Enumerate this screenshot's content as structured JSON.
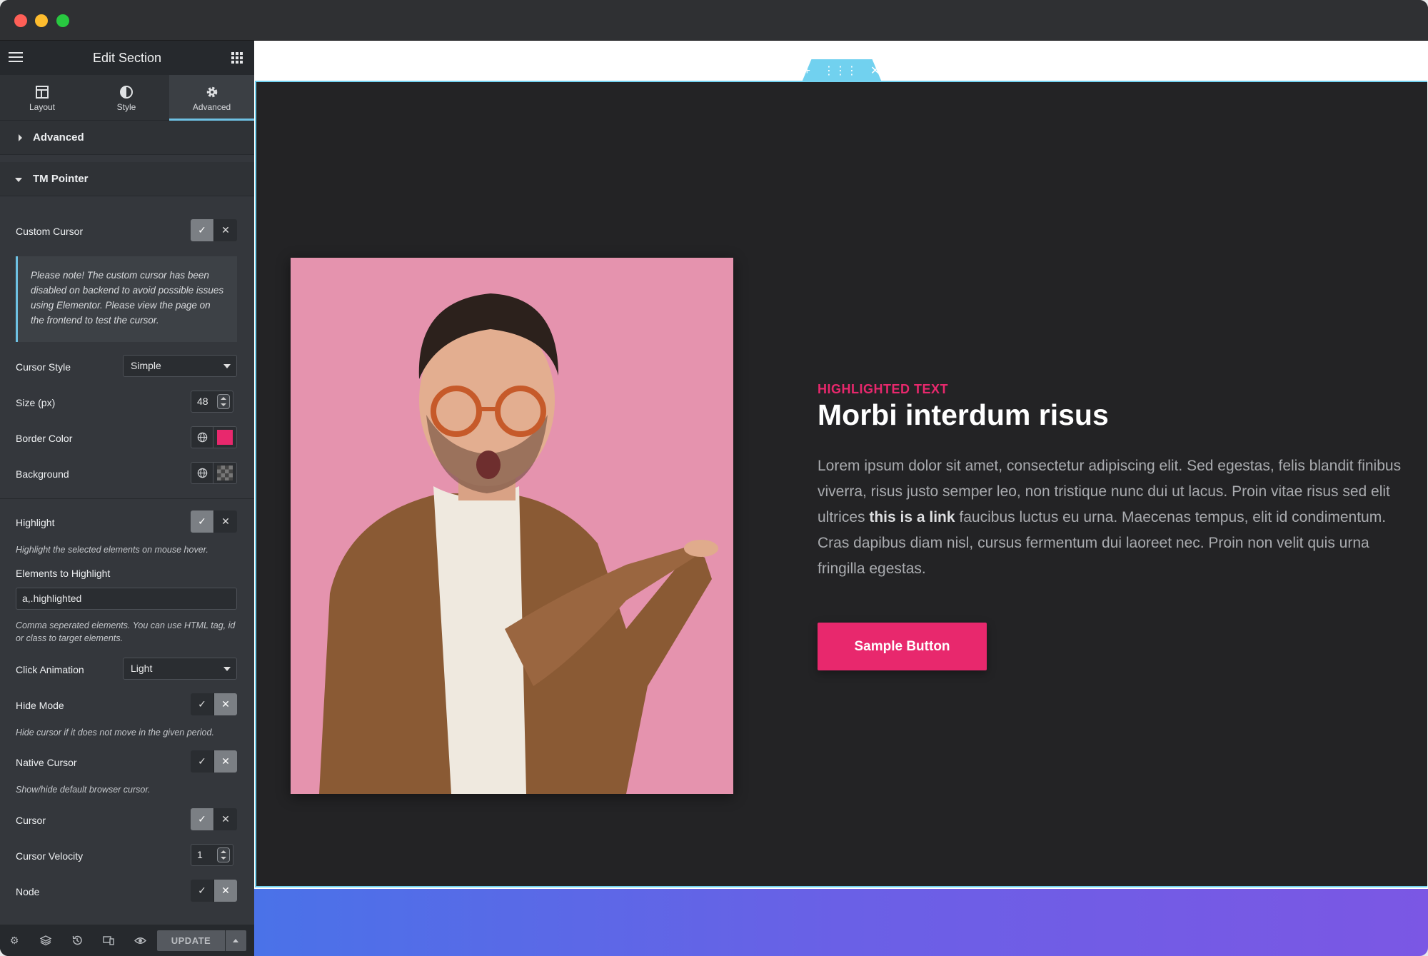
{
  "window": {
    "controls": [
      "close",
      "minimize",
      "maximize"
    ]
  },
  "panel": {
    "title": "Edit Section",
    "tabs": [
      {
        "label": "Layout",
        "icon": "layout-icon"
      },
      {
        "label": "Style",
        "icon": "style-icon"
      },
      {
        "label": "Advanced",
        "icon": "gear-icon",
        "active": true
      }
    ],
    "sections": {
      "advanced": "Advanced",
      "tm_pointer": "TM Pointer"
    },
    "custom_cursor": {
      "label": "Custom Cursor",
      "value": "on"
    },
    "note": "Please note! The custom cursor has been disabled on backend to avoid possible issues using Elementor. Please view the page on the frontend to test the cursor.",
    "cursor_style": {
      "label": "Cursor Style",
      "value": "Simple"
    },
    "size": {
      "label": "Size (px)",
      "value": "48"
    },
    "border_color": {
      "label": "Border Color",
      "value": "#e8286d"
    },
    "background": {
      "label": "Background"
    },
    "highlight": {
      "label": "Highlight",
      "value": "on",
      "hint": "Highlight the selected elements on mouse hover."
    },
    "elements_to_highlight": {
      "label": "Elements to Highlight",
      "value": "a,.highlighted",
      "hint": "Comma seperated elements. You can use HTML tag, id or class to target elements."
    },
    "click_animation": {
      "label": "Click Animation",
      "value": "Light"
    },
    "hide_mode": {
      "label": "Hide Mode",
      "value": "off",
      "hint": "Hide cursor if it does not move in the given period."
    },
    "native_cursor": {
      "label": "Native Cursor",
      "value": "off",
      "hint": "Show/hide default browser cursor."
    },
    "cursor": {
      "label": "Cursor",
      "value": "on"
    },
    "cursor_velocity": {
      "label": "Cursor Velocity",
      "value": "1"
    },
    "node": {
      "label": "Node",
      "value": "off"
    },
    "footer": {
      "update_label": "UPDATE"
    }
  },
  "canvas": {
    "highlighted_text": "HIGHLIGHTED TEXT",
    "heading": "Morbi interdum risus",
    "para_before": "Lorem ipsum dolor sit amet, consectetur adipiscing elit. Sed egestas, felis blandit finibus viverra, risus justo semper leo, non tristique nunc dui ut lacus. Proin vitae risus sed elit ultrices ",
    "para_link": "this is a link",
    "para_after": " faucibus luctus eu urna. Maecenas tempus, elit id condimentum. Cras dapibus diam nisl, cursus fermentum dui laoreet nec. Proin non velit quis urna fringilla egestas.",
    "button_label": "Sample Button",
    "accent": "#e8286d",
    "editor_blue": "#71d1ef"
  }
}
